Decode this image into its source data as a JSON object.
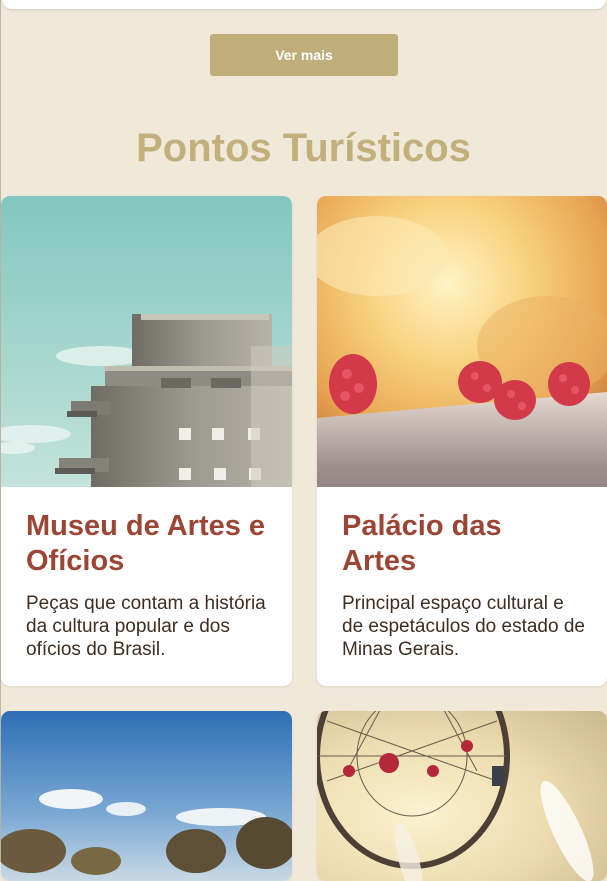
{
  "buttons": {
    "see_more": "Ver mais"
  },
  "section": {
    "title": "Pontos Turísticos"
  },
  "cards": [
    {
      "title": "Museu de Artes e Ofícios",
      "description": "Peças que contam a história da cultura popular e dos ofícios do Brasil.",
      "image": "concrete-tower-photo"
    },
    {
      "title": "Palácio das Artes",
      "description": "Principal espaço cultural e de espetáculos do estado de Minas Gerais.",
      "image": "raspberries-photo"
    },
    {
      "image": "trees-sky-photo"
    },
    {
      "image": "dreamcatcher-photo"
    }
  ],
  "colors": {
    "background": "#f0e9da",
    "accent": "#bfae7a",
    "card_title": "#9b4535",
    "card_text": "#3f2d21"
  }
}
